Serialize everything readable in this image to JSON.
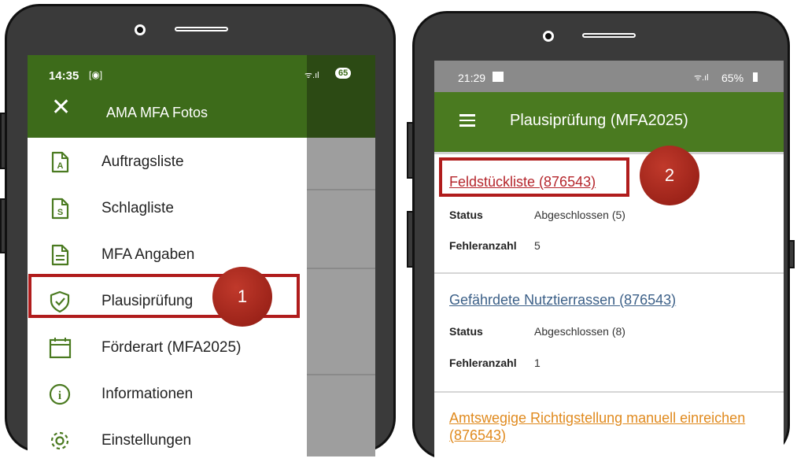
{
  "left_phone": {
    "status_time": "14:35",
    "status_battery": "65",
    "drawer_title": "AMA MFA Fotos",
    "menu_items": [
      {
        "label": "Auftragsliste",
        "icon": "document-a-icon"
      },
      {
        "label": "Schlagliste",
        "icon": "document-s-icon"
      },
      {
        "label": "MFA Angaben",
        "icon": "document-lines-icon"
      },
      {
        "label": "Plausiprüfung",
        "icon": "shield-check-icon"
      },
      {
        "label": "Förderart (MFA2025)",
        "icon": "calendar-icon"
      },
      {
        "label": "Informationen",
        "icon": "info-icon"
      },
      {
        "label": "Einstellungen",
        "icon": "gear-icon"
      }
    ],
    "callout": "1"
  },
  "right_phone": {
    "status_time": "21:29",
    "status_battery": "65%",
    "app_title": "Plausiprüfung (MFA2025)",
    "cards": [
      {
        "title": "Feldstückliste  (876543)",
        "status_label": "Status",
        "status_value": "Abgeschlossen (5)",
        "errors_label": "Fehleranzahl",
        "errors_value": "5"
      },
      {
        "title": "Gefährdete Nutztierrassen  (876543)",
        "status_label": "Status",
        "status_value": "Abgeschlossen (8)",
        "errors_label": "Fehleranzahl",
        "errors_value": "1"
      },
      {
        "title": "Amtswegige Richtigstellung manuell einreichen",
        "title_line2": "(876543)"
      }
    ],
    "callout": "2"
  },
  "colors": {
    "header_green": "#4a7a20",
    "status_green": "#3d6b1a",
    "highlight_red": "#b01c1c",
    "link_red": "#b5262c",
    "link_blue": "#3b5f87",
    "link_orange": "#e08a1e"
  }
}
